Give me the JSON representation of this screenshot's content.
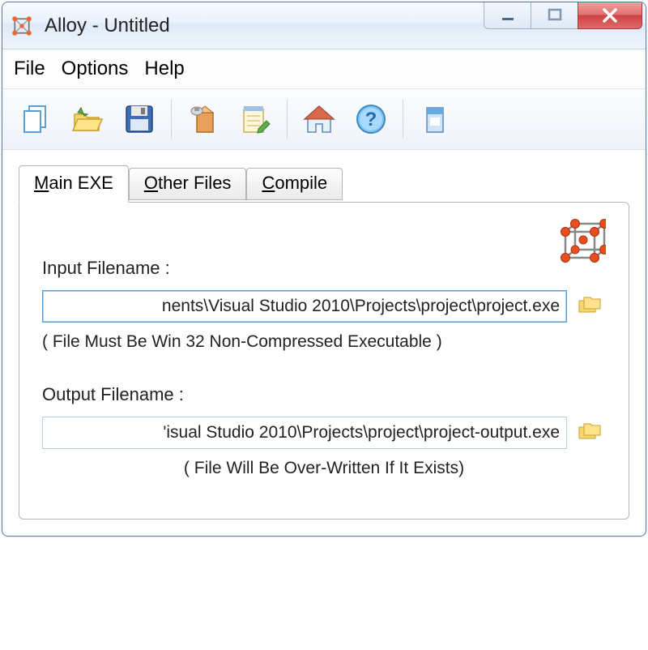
{
  "window": {
    "title": "Alloy - Untitled"
  },
  "menu": {
    "file": "File",
    "options": "Options",
    "help": "Help"
  },
  "tabs": {
    "main_exe": {
      "u": "M",
      "rest": "ain EXE"
    },
    "other_files": {
      "u": "O",
      "rest": "ther Files"
    },
    "compile": {
      "u": "C",
      "rest": "ompile"
    }
  },
  "main_tab": {
    "input_label": "Input Filename :",
    "input_value": "nents\\Visual Studio 2010\\Projects\\project\\project.exe",
    "input_hint": "( File Must Be Win 32 Non-Compressed Executable )",
    "output_label": "Output Filename :",
    "output_value": "'isual Studio 2010\\Projects\\project\\project-output.exe",
    "output_hint": "( File Will Be Over-Written If It Exists)"
  }
}
